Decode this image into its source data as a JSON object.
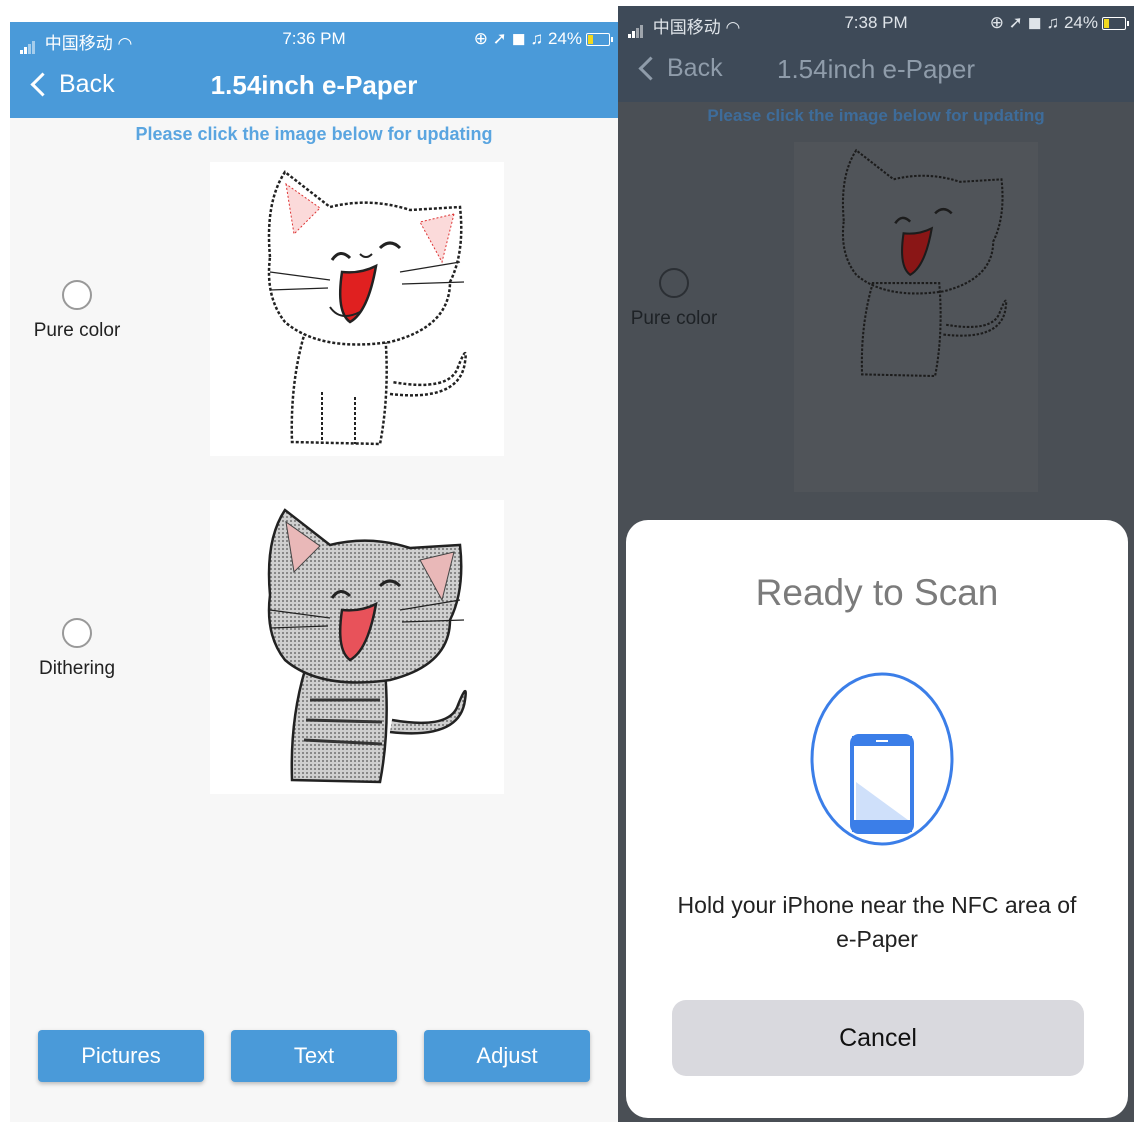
{
  "left": {
    "status": {
      "carrier": "中国移动",
      "time": "7:36 PM",
      "indicators": "⊕ ➚ ◼ ♫ 24%",
      "battery_level": 0.24
    },
    "nav": {
      "back_label": "Back",
      "title": "1.54inch e-Paper"
    },
    "hint": "Please click the image below for updating",
    "options": {
      "pure_color": "Pure color",
      "dithering": "Dithering"
    },
    "buttons": {
      "pictures": "Pictures",
      "text": "Text",
      "adjust": "Adjust"
    }
  },
  "right": {
    "status": {
      "carrier": "中国移动",
      "time": "7:38 PM",
      "indicators": "⊕ ➚ ◼ ♫ 24%",
      "battery_level": 0.24
    },
    "nav": {
      "back_label": "Back",
      "title": "1.54inch e-Paper"
    },
    "hint": "Please click the image below for updating",
    "options": {
      "pure_color": "Pure color"
    },
    "sheet": {
      "title": "Ready to Scan",
      "message": "Hold your iPhone near the NFC area of e-Paper",
      "cancel_label": "Cancel"
    }
  },
  "colors": {
    "accent": "#4a9ad9",
    "hint_text": "#5aa5e0",
    "dim_overlay": "#4a4f55",
    "scan_icon": "#3b7ee8"
  }
}
